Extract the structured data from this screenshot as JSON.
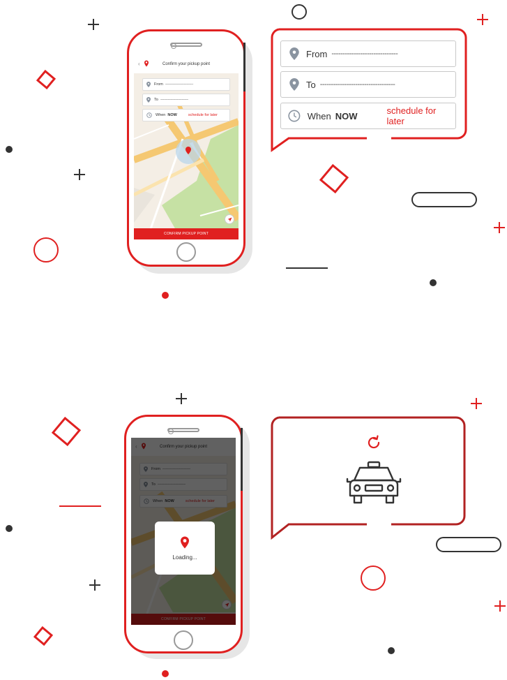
{
  "colors": {
    "accent": "#e02020",
    "dark": "#333333",
    "map_road": "#f5c872",
    "map_park": "#c6e1a4"
  },
  "screen": {
    "title": "Confirm your pickup point",
    "from_label": "From",
    "from_placeholder": "------------------------------",
    "to_label": "To",
    "to_placeholder": "------------------------------",
    "when_label": "When",
    "when_value": "NOW",
    "schedule_label": "schedule for later",
    "confirm_button": "CONFIRM PICKUP POINT",
    "icons": [
      "back-icon",
      "logo-icon",
      "location-pin-icon",
      "clock-icon",
      "navigate-icon"
    ]
  },
  "callout_top": {
    "from_label": "From",
    "from_placeholder": "------------------------------",
    "to_label": "To",
    "to_placeholder": "----------------------------------",
    "when_label": "When",
    "when_value": "NOW",
    "schedule_label": "schedule for later"
  },
  "loading": {
    "text": "Loading..."
  },
  "callout_bottom": {
    "icons": [
      "refresh-icon",
      "taxi-car-icon"
    ]
  }
}
